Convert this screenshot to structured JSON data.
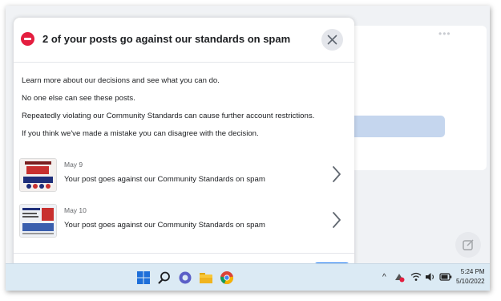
{
  "dialog": {
    "title": "2 of your posts go against our standards on spam",
    "lines": [
      "Learn more about our decisions and see what you can do.",
      "No one else can see these posts.",
      "Repeatedly violating our Community Standards can cause further account restrictions.",
      "If you think we've made a mistake you can disagree with the decision."
    ],
    "posts": [
      {
        "date": "May 9",
        "text": "Your post goes against our Community Standards on spam"
      },
      {
        "date": "May 10",
        "text": "Your post goes against our Community Standards on spam"
      }
    ],
    "close_icon": "close-icon"
  },
  "taskbar": {
    "icons": [
      "windows-start-icon",
      "search-icon",
      "chat-icon",
      "file-explorer-icon",
      "chrome-icon"
    ],
    "tray_icons": [
      "chevron-up-icon",
      "network-icon",
      "wifi-icon",
      "volume-icon",
      "battery-icon"
    ],
    "time": "5:24 PM",
    "date": "5/10/2022"
  },
  "colors": {
    "accent": "#1877f2",
    "warning": "#e41e3f",
    "taskbar": "#dbeaf4"
  }
}
